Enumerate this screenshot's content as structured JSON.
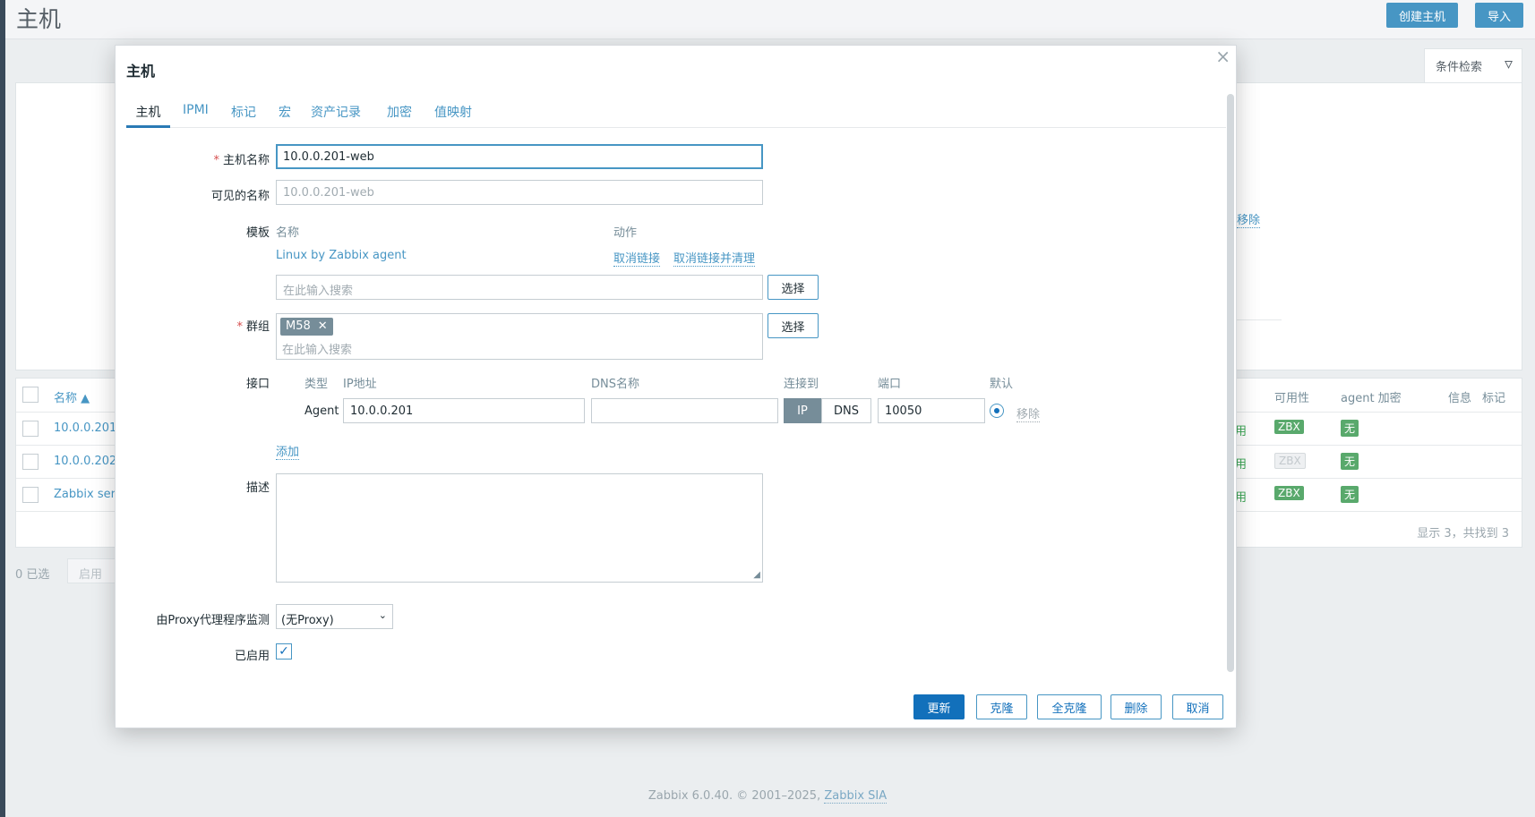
{
  "page": {
    "title": "主机",
    "create_host_label": "创建主机",
    "import_label": "导入",
    "filter_label": "条件检索",
    "background_remove": "移除",
    "footer_text": "Zabbix 6.0.40. © 2001–2025, ",
    "footer_link": "Zabbix SIA"
  },
  "table": {
    "columns": {
      "name": "名称 ▲",
      "availability": "可用性",
      "agent_encryption": "agent 加密",
      "info": "信息",
      "tags": "标记"
    },
    "rows": [
      {
        "name": "10.0.0.201",
        "status": "用",
        "availability": "ZBX",
        "availability_active": true,
        "encryption": "无"
      },
      {
        "name": "10.0.0.202",
        "status": "用",
        "availability": "ZBX",
        "availability_active": false,
        "encryption": "无"
      },
      {
        "name": "Zabbix ser",
        "status": "用",
        "availability": "ZBX",
        "availability_active": true,
        "encryption": "无"
      }
    ],
    "footer": "显示 3，共找到 3",
    "selected_count": "0 已选",
    "enable_label": "启用"
  },
  "modal": {
    "title": "主机",
    "close_symbol": "×",
    "tabs": [
      "主机",
      "IPMI",
      "标记",
      "宏",
      "资产记录",
      "加密",
      "值映射"
    ],
    "host_name_label": "主机名称",
    "host_name_value": "10.0.0.201-web",
    "visible_name_label": "可见的名称",
    "visible_name_placeholder": "10.0.0.201-web",
    "templates_label": "模板",
    "templates_col_name": "名称",
    "templates_col_action": "动作",
    "template_item": "Linux by Zabbix agent",
    "unlink_label": "取消链接",
    "unlink_clear_label": "取消链接并清理",
    "search_placeholder": "在此输入搜索",
    "select_label": "选择",
    "groups_label": "群组",
    "group_chip": "M58",
    "interfaces_label": "接口",
    "iface_cols": {
      "type": "类型",
      "ip": "IP地址",
      "dns": "DNS名称",
      "connect": "连接到",
      "port": "端口",
      "default": "默认"
    },
    "iface_type": "Agent",
    "iface_ip": "10.0.0.201",
    "iface_dns": "",
    "connect_ip": "IP",
    "connect_dns": "DNS",
    "iface_port": "10050",
    "iface_remove": "移除",
    "add_label": "添加",
    "description_label": "描述",
    "proxy_label": "由Proxy代理程序监测",
    "proxy_value": "(无Proxy)",
    "enabled_label": "已启用",
    "enabled": true,
    "buttons": {
      "update": "更新",
      "clone": "克隆",
      "full_clone": "全克隆",
      "delete": "删除",
      "cancel": "取消"
    }
  },
  "colors": {
    "primary": "#1270bb",
    "link": "#4796c4",
    "status_green": "#59a96c"
  }
}
